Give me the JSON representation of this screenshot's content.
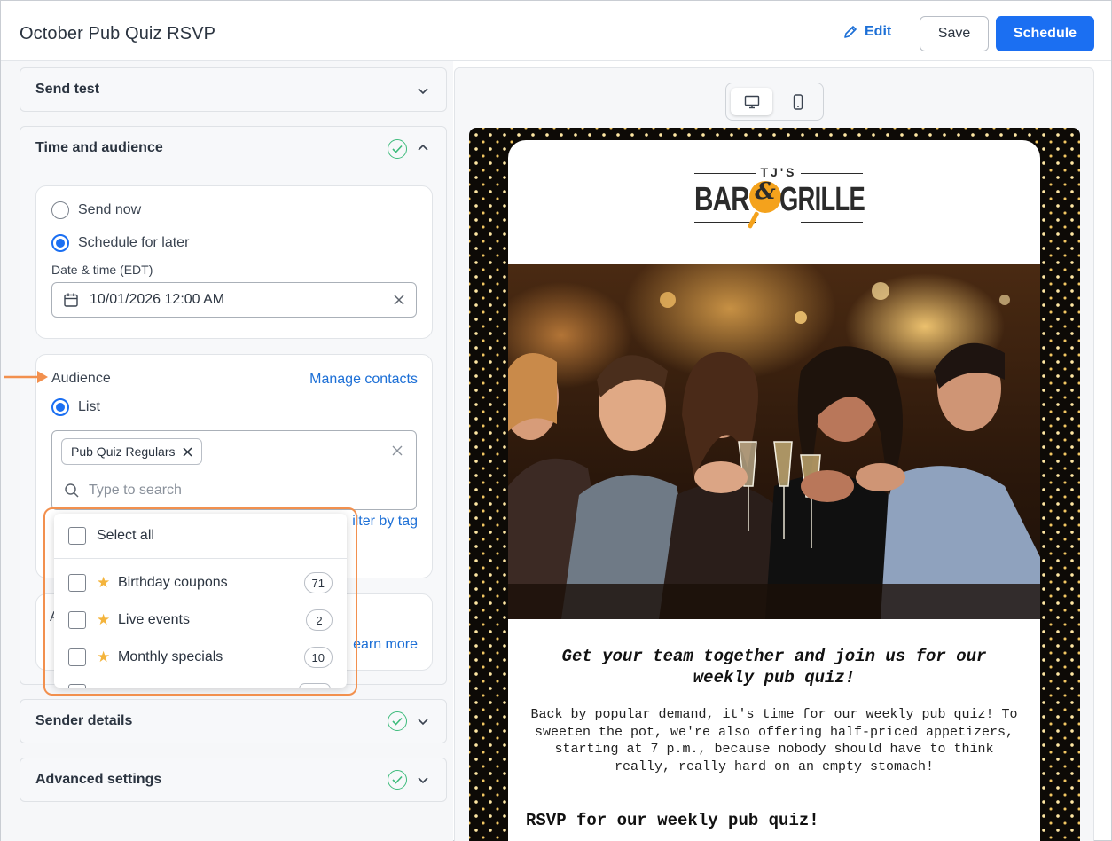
{
  "header": {
    "title": "October Pub Quiz RSVP",
    "edit_label": "Edit",
    "save_label": "Save",
    "schedule_label": "Schedule"
  },
  "sections": {
    "send_test": "Send test",
    "time_audience": "Time and audience",
    "sender_details": "Sender details",
    "advanced_settings": "Advanced settings"
  },
  "timing": {
    "send_now": "Send now",
    "schedule_later": "Schedule for later",
    "selected": "schedule_later",
    "date_label": "Date & time (EDT)",
    "date_value": "10/01/2026 12:00 AM"
  },
  "audience": {
    "label": "Audience",
    "manage_link": "Manage contacts",
    "list_option": "List",
    "selected_chip": "Pub Quiz Regulars",
    "search_placeholder": "Type to search",
    "filter_link_partial": "ilter by tag",
    "learn_more_partial": "earn more",
    "peek_a": "A"
  },
  "dropdown": {
    "select_all": "Select all",
    "items": [
      {
        "label": "Birthday coupons",
        "count": "71",
        "checked": false
      },
      {
        "label": "Live events",
        "count": "2",
        "checked": false
      },
      {
        "label": "Monthly specials",
        "count": "10",
        "checked": false
      }
    ]
  },
  "preview": {
    "view_mode": "desktop",
    "logo_top": "TJ'S",
    "logo_left": "BAR",
    "logo_amp": "&",
    "logo_right": "GRILLE",
    "heading": "Get your team together and join us for our weekly pub quiz!",
    "body": "Back by popular demand, it's time for our weekly pub quiz! To sweeten the pot, we're also offering half-priced appetizers, starting at 7 p.m., because nobody should have to think really, really hard on an empty stomach!",
    "rsvp": "RSVP for our weekly pub quiz!"
  },
  "colors": {
    "primary": "#1b6ff2",
    "link": "#1c6fd6",
    "success": "#3dbb7b",
    "highlight": "#f2904e",
    "star": "#f4b43c"
  }
}
